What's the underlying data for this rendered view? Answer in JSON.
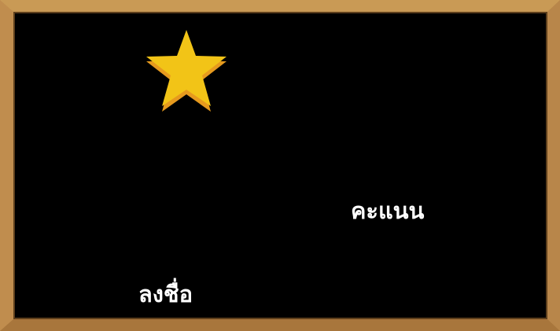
{
  "board": {
    "frame_color": "#c08d4e",
    "background_color": "#000000"
  },
  "star": {
    "icon": "star-icon",
    "color": "#f2c417",
    "shadow_color": "#e69a1e"
  },
  "score": {
    "label": "คะแนน"
  },
  "register": {
    "label": "ลงชื่อ"
  }
}
